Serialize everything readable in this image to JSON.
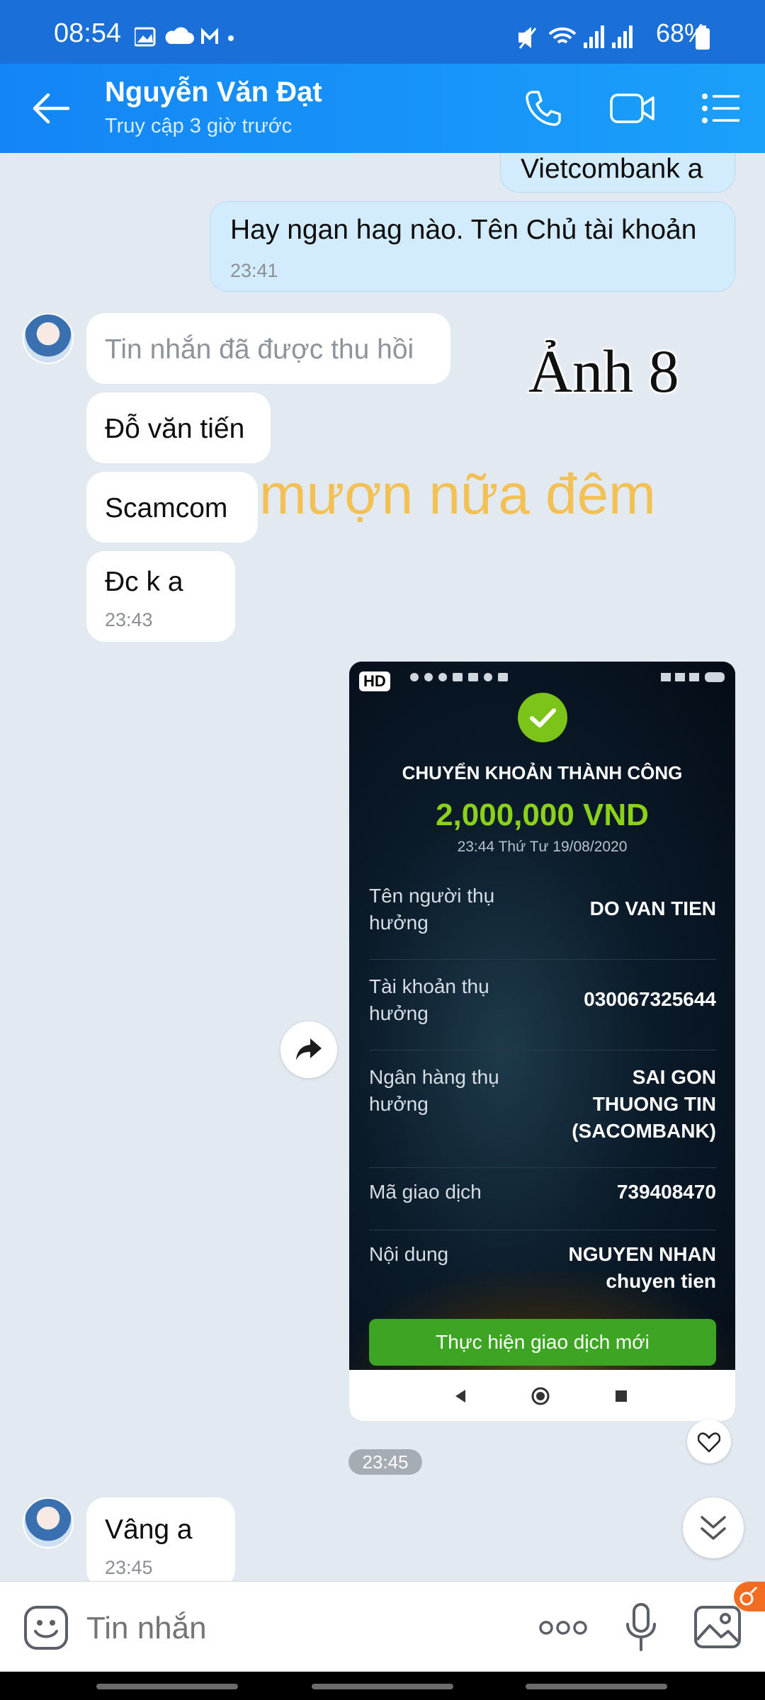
{
  "status_bar": {
    "time": "08:54",
    "battery": "68%"
  },
  "header": {
    "contact_name": "Nguyễn Văn Đạt",
    "last_seen": "Truy cập 3 giờ trước"
  },
  "messages": {
    "partial_out": "Vietcombank a",
    "out_1": {
      "text": "Hay ngan hag nào. Tên Chủ tài khoản",
      "time": "23:41"
    },
    "recalled": "Tin nhắn đã được thu hồi",
    "in_name": "Đỗ văn tiến",
    "in_bank": "Scamcom",
    "in_ok": {
      "text": "Đc k a",
      "time": "23:43"
    },
    "image_time": "23:45",
    "in_last": {
      "text": "Vâng a",
      "time": "23:45"
    }
  },
  "overlay": {
    "label": "Ảnh 8",
    "watermark": "mượn nữa đêm"
  },
  "transaction_screenshot": {
    "hd_badge": "HD",
    "title": "CHUYỂN KHOẢN THÀNH CÔNG",
    "amount": "2,000,000 VND",
    "datetime": "23:44 Thứ Tư 19/08/2020",
    "rows": [
      {
        "label": "Tên người thụ hưởng",
        "value": "DO VAN TIEN"
      },
      {
        "label": "Tài khoản thụ hưởng",
        "value": "030067325644"
      },
      {
        "label": "Ngân hàng thụ hưởng",
        "value": "SAI GON THUONG TIN (SACOMBANK)"
      },
      {
        "label": "Mã giao dịch",
        "value": "739408470"
      },
      {
        "label": "Nội dung",
        "value": "NGUYEN NHAN chuyen tien"
      }
    ],
    "button": "Thực hiện giao dịch mới"
  },
  "input": {
    "placeholder": "Tin nhắn"
  },
  "icons": {
    "back": "arrow-left-icon",
    "call": "phone-icon",
    "video": "video-camera-icon",
    "menu": "list-menu-icon",
    "forward": "share-icon",
    "like": "heart-icon",
    "scroll_down": "double-chevron-down-icon",
    "sticker": "smiley-icon",
    "more": "more-dots-icon",
    "mic": "microphone-icon",
    "gallery": "image-icon"
  },
  "colors": {
    "header": "#1a8ff8",
    "incoming_bubble": "#ffffff",
    "outgoing_bubble": "#d3ecfd",
    "amount_green": "#8bd11a",
    "button_green": "#3ea524",
    "watermark": "#f3c053"
  }
}
